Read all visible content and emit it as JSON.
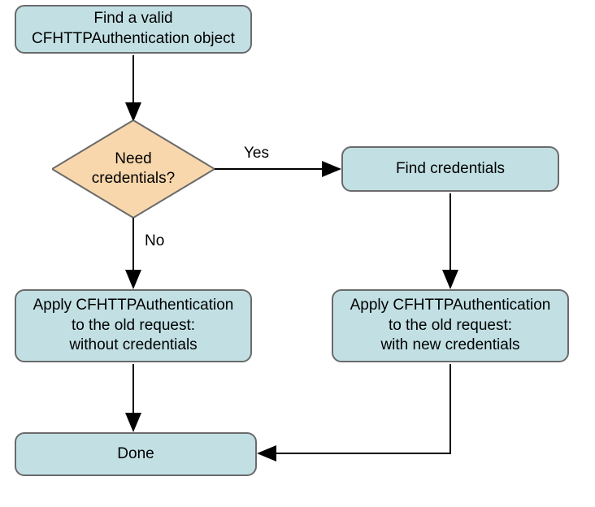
{
  "nodes": {
    "find_valid": "Find a valid\nCFHTTPAuthentication object",
    "need_credentials": "Need\ncredentials?",
    "find_credentials": "Find credentials",
    "apply_without": "Apply CFHTTPAuthentication\nto the old request:\nwithout credentials",
    "apply_with": "Apply CFHTTPAuthentication\nto the old request:\nwith new credentials",
    "done": "Done"
  },
  "labels": {
    "yes": "Yes",
    "no": "No"
  }
}
